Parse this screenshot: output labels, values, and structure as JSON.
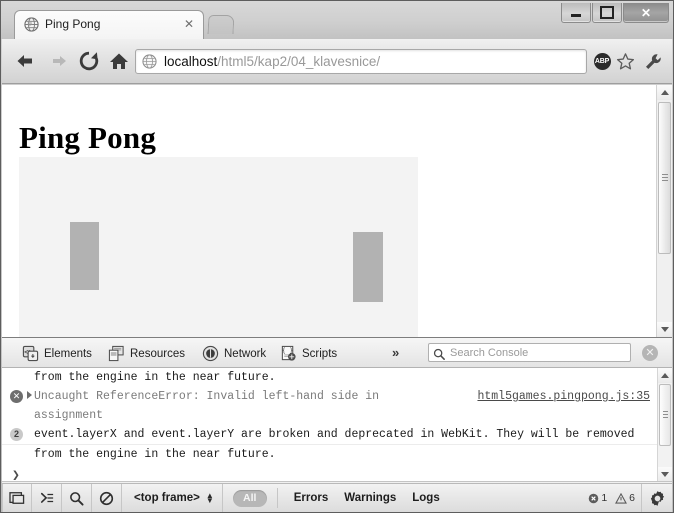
{
  "window": {
    "controls": {
      "minimize": "minimize-button",
      "maximize": "maximize-button",
      "close": "✕"
    }
  },
  "tab": {
    "title": "Ping Pong",
    "close": "✕",
    "favicon": "globe-icon"
  },
  "toolbar": {
    "back": "back-arrow-icon",
    "forward": "forward-arrow-icon",
    "reload": "reload-icon",
    "home": "home-icon",
    "url_host": "localhost",
    "url_path": "/html5/kap2/04_klavesnice/",
    "abp_label": "ABP",
    "star": "star-icon",
    "wrench": "wrench-icon"
  },
  "page": {
    "heading": "Ping Pong",
    "game": {
      "canvas_bg": "#f3f3f3",
      "paddle_color": "#b2b2b2",
      "ball_color": "#c8c8c8"
    }
  },
  "devtools": {
    "tabs": [
      {
        "label": "Elements",
        "icon": "elements-icon"
      },
      {
        "label": "Resources",
        "icon": "resources-icon"
      },
      {
        "label": "Network",
        "icon": "network-icon"
      },
      {
        "label": "Scripts",
        "icon": "scripts-icon"
      }
    ],
    "more": "»",
    "search_placeholder": "Search Console",
    "close_label": "✕",
    "console": {
      "messages": [
        {
          "type": "continuation",
          "text": "from the engine in the near future."
        },
        {
          "type": "error",
          "text": "Uncaught ReferenceError: Invalid left-hand side in",
          "text2": "assignment",
          "source": "html5games.pingpong.js:35"
        },
        {
          "type": "warning",
          "count": "2",
          "text": "event.layerX and event.layerY are broken and deprecated in WebKit. They will be removed",
          "text2": "from the engine in the near future."
        }
      ],
      "prompt": "❯"
    },
    "status": {
      "dock_icon": "dock-to-side-icon",
      "console_icon": "show-console-icon",
      "search_icon": "search-icon",
      "clear_icon": "clear-console-icon",
      "frame_value": "<top frame>",
      "all_label": "All",
      "filters": [
        "Errors",
        "Warnings",
        "Logs"
      ],
      "error_count": "1",
      "warning_count": "6",
      "settings_icon": "gear-icon"
    }
  }
}
